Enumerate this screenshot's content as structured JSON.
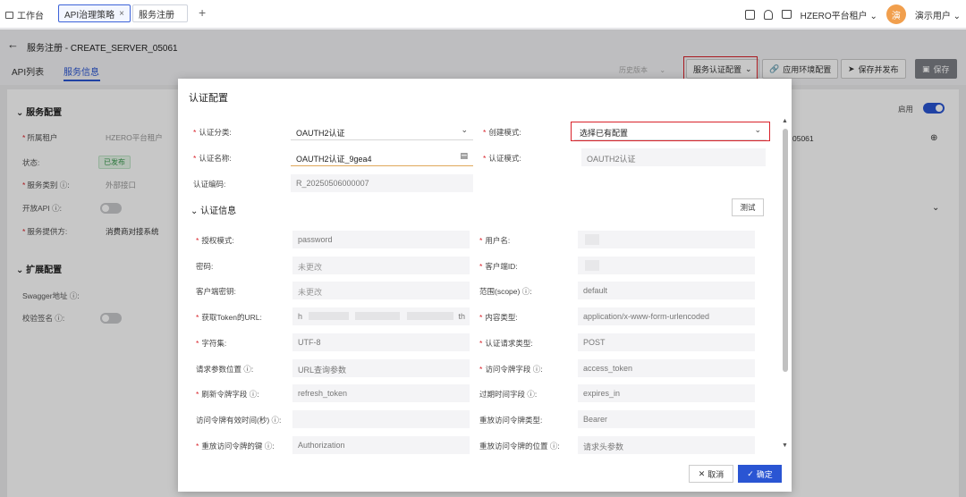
{
  "topbar": {
    "home": "工作台",
    "tabs": [
      "API治理策略",
      "服务注册"
    ],
    "close": "×",
    "add": "+",
    "tenant": "HZERO平台租户",
    "avatar_char": "演",
    "user": "演示用户"
  },
  "header": {
    "back": "←",
    "title": "服务注册 - CREATE_SERVER_05061",
    "tabs": [
      "API列表",
      "服务信息"
    ],
    "history": "历史版本",
    "auth_config_btn": "服务认证配置",
    "env_config_btn": "应用环境配置",
    "save_publish_btn": "保存并发布",
    "save_btn": "保存"
  },
  "background": {
    "section1": "服务配置",
    "enable_label": "启用",
    "tenant_label": "所属租户",
    "tenant_value": "HZERO平台租户",
    "status_label": "状态:",
    "status_value": "已发布",
    "type_label": "服务类别",
    "type_value": "外部接口",
    "open_api_label": "开放API",
    "provider_label": "服务提供方",
    "provider_value": "消费商对接系统",
    "code_partial": "05061",
    "section2": "扩展配置",
    "swagger_label": "Swagger地址",
    "sign_label": "校验签名"
  },
  "modal": {
    "title": "认证配置",
    "fields": {
      "category_label": "认证分类:",
      "category_value": "OAUTH2认证",
      "create_mode_label": "创建模式:",
      "create_mode_value": "选择已有配置",
      "name_label": "认证名称:",
      "name_value": "OAUTH2认证_9gea4",
      "mode_label": "认证模式:",
      "mode_value": "OAUTH2认证",
      "code_label": "认证编码:",
      "code_value": "R_20250506000007"
    },
    "section": "认证信息",
    "test_btn": "测试",
    "rows": [
      {
        "l1": "授权模式:",
        "v1": "password",
        "l2": "用户名:",
        "v2": ""
      },
      {
        "l1": "密码:",
        "v1": "未更改",
        "l2": "客户端ID:",
        "v2": ""
      },
      {
        "l1": "客户端密钥:",
        "v1": "未更改",
        "l2": "范围(scope)",
        "v2": "default"
      },
      {
        "l1": "获取Token的URL:",
        "v1": "h",
        "v1b": "th",
        "l2": "内容类型:",
        "v2": "application/x-www-form-urlencoded"
      },
      {
        "l1": "字符集:",
        "v1": "UTF-8",
        "l2": "认证请求类型:",
        "v2": "POST"
      },
      {
        "l1": "请求参数位置",
        "v1": "URL查询参数",
        "l2": "访问令牌字段",
        "v2": "access_token"
      },
      {
        "l1": "刷新令牌字段",
        "v1": "refresh_token",
        "l2": "过期时间字段",
        "v2": "expires_in"
      },
      {
        "l1": "访问令牌有效时间(秒)",
        "v1": "",
        "l2": "重放访问令牌类型:",
        "v2": "Bearer"
      },
      {
        "l1": "重放访问令牌的键",
        "v1": "Authorization",
        "l2": "重放访问令牌的位置",
        "v2": "请求头参数"
      }
    ],
    "cancel": "取消",
    "ok": "确定"
  },
  "colors": {
    "primary": "#2a55d3",
    "required": "#d9222a",
    "highlight": "#d9222a"
  }
}
